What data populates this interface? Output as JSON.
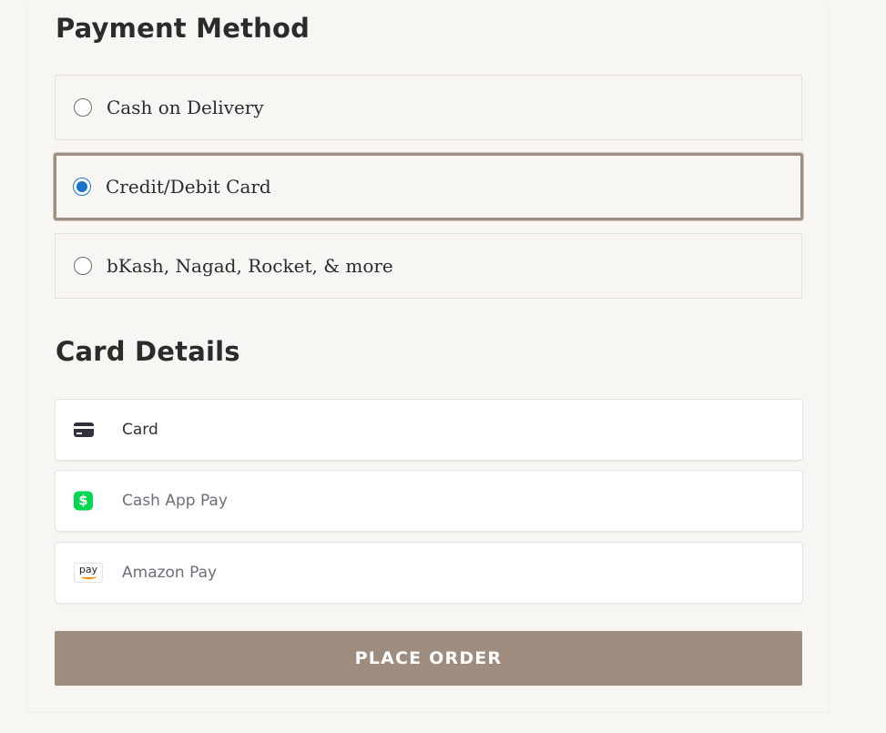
{
  "payment_method": {
    "title": "Payment Method",
    "options": [
      {
        "label": "Cash on Delivery",
        "selected": false
      },
      {
        "label": "Credit/Debit Card",
        "selected": true
      },
      {
        "label": "bKash, Nagad, Rocket, & more",
        "selected": false
      }
    ]
  },
  "card_details": {
    "title": "Card Details",
    "methods": [
      {
        "label": "Card",
        "icon": "credit-card-icon"
      },
      {
        "label": "Cash App Pay",
        "icon": "cash-app-icon",
        "icon_glyph": "$"
      },
      {
        "label": "Amazon Pay",
        "icon": "amazon-pay-icon",
        "icon_glyph": "pay"
      }
    ]
  },
  "place_order": {
    "label": "PLACE ORDER"
  },
  "colors": {
    "accent_button": "#9e8c7e",
    "selected_border": "#9e8f85",
    "radio_selected": "#1a73c8",
    "cash_app_green": "#00d64f",
    "amazon_orange": "#f08804"
  }
}
